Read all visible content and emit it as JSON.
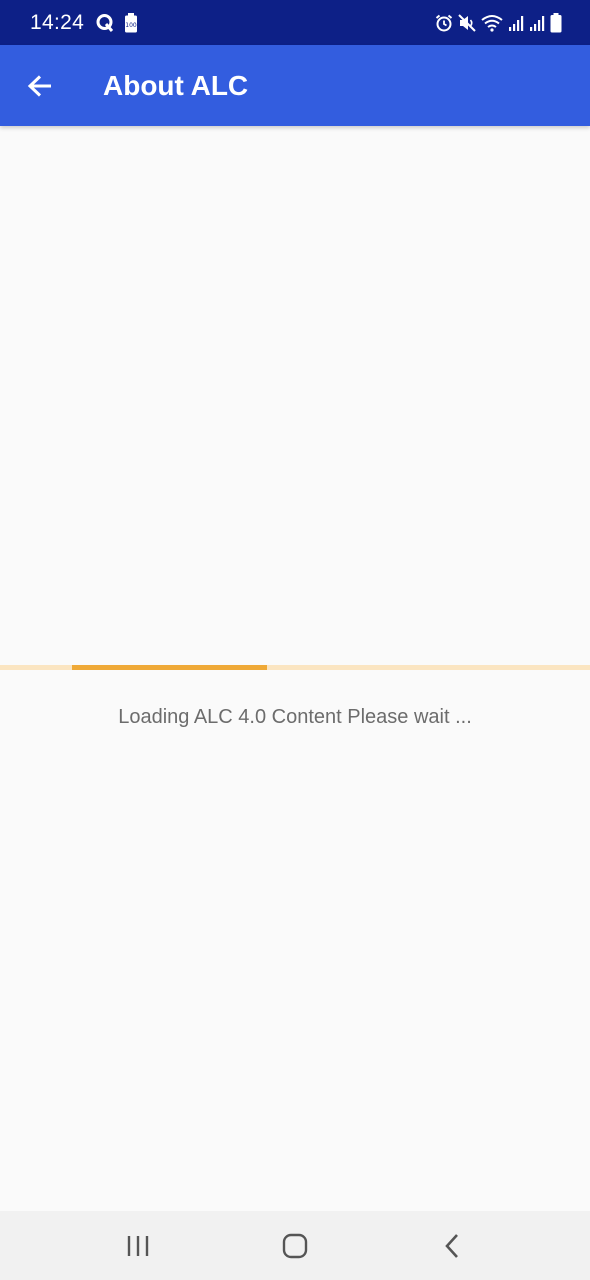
{
  "status_bar": {
    "time": "14:24",
    "icons_left": [
      "q-notification-icon",
      "battery-saver-icon"
    ],
    "icons_right": [
      "alarm-icon",
      "mute-icon",
      "wifi-icon",
      "signal-1-icon",
      "signal-2-icon",
      "battery-icon"
    ],
    "background": "#0d2087"
  },
  "app_bar": {
    "title": "About ALC",
    "back_icon": "arrow-back-icon",
    "background": "#335ddf"
  },
  "loading": {
    "message": "Loading ALC 4.0 Content Please wait ...",
    "progress_fraction": 0.33,
    "progress_color": "#efa937",
    "track_color": "#fbe5c1"
  },
  "nav_bar": {
    "buttons": [
      "recent-apps-icon",
      "home-icon",
      "back-icon"
    ]
  }
}
